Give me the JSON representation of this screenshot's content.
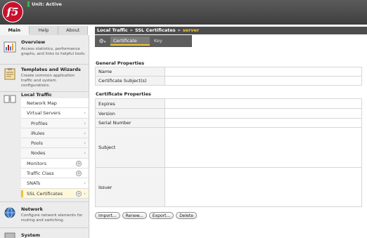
{
  "header": {
    "logo_text": "f5",
    "status": "Unit: Active"
  },
  "left_tabs": [
    "Main",
    "Help",
    "About"
  ],
  "sidebar": {
    "overview": {
      "title": "Overview",
      "desc": "Access statistics, performance graphs, and links to helpful tools."
    },
    "templates": {
      "title": "Templates and Wizards",
      "desc": "Create common application traffic and system configurations."
    },
    "local_traffic": {
      "title": "Local Traffic"
    },
    "nav": [
      {
        "label": "Network Map"
      },
      {
        "label": "Virtual Servers"
      },
      {
        "label": "Profiles"
      },
      {
        "label": "iRules"
      },
      {
        "label": "Pools"
      },
      {
        "label": "Nodes"
      },
      {
        "label": "Monitors"
      },
      {
        "label": "Traffic Class"
      },
      {
        "label": "SNATs"
      },
      {
        "label": "SSL Certificates"
      }
    ],
    "network": {
      "title": "Network",
      "desc": "Configure network elements for routing and switching."
    },
    "system": {
      "title": "System"
    }
  },
  "breadcrumb": {
    "part1": "Local Traffic",
    "sep": "»",
    "part2": "SSL Certificates",
    "current": "server"
  },
  "page_tabs": [
    "Certificate",
    "Key"
  ],
  "general": {
    "title": "General Properties",
    "rows": [
      {
        "label": "Name"
      },
      {
        "label": "Certificate Subject(s)"
      }
    ]
  },
  "cert": {
    "title": "Certificate Properties",
    "rows": [
      {
        "label": "Expires"
      },
      {
        "label": "Version"
      },
      {
        "label": "Serial Number"
      },
      {
        "label": "Subject"
      },
      {
        "label": "Issuer"
      }
    ]
  },
  "buttons": {
    "import": "Import...",
    "renew": "Renew...",
    "export": "Export...",
    "delete": "Delete"
  },
  "colors": {
    "accent": "#f2c832",
    "brand": "#c8102e",
    "status_ok": "#3fb34f"
  }
}
